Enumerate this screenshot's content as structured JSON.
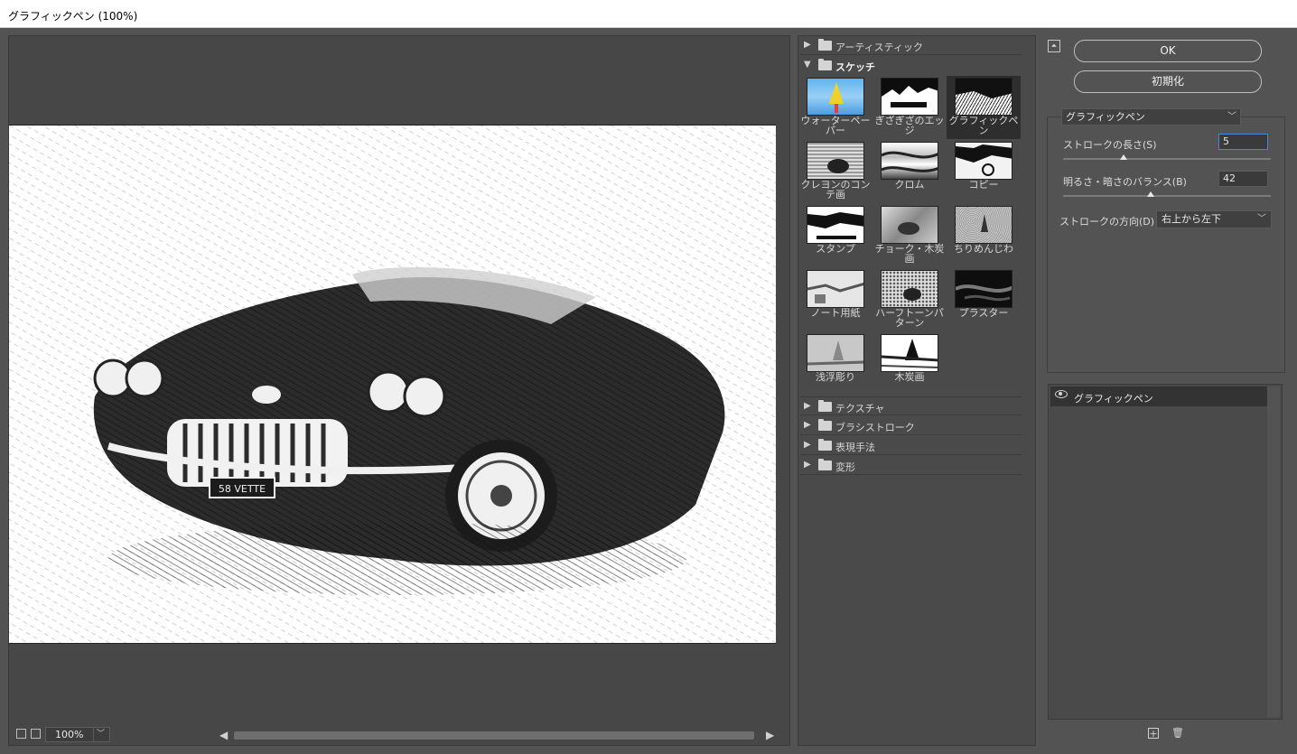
{
  "window": {
    "title": "グラフィックペン (100%)"
  },
  "preview": {
    "zoom": "100%",
    "plate_text": "58 VETTE"
  },
  "filters": {
    "categories_top": [
      {
        "label": "アーティスティック",
        "expanded": false
      },
      {
        "label": "スケッチ",
        "expanded": true
      }
    ],
    "thumbnails": [
      {
        "label": "ウォーターペーパー",
        "selected": false
      },
      {
        "label": "ぎざぎざのエッジ",
        "selected": false
      },
      {
        "label": "グラフィックペン",
        "selected": true
      },
      {
        "label": "クレヨンのコンテ画",
        "selected": false
      },
      {
        "label": "クロム",
        "selected": false
      },
      {
        "label": "コピー",
        "selected": false
      },
      {
        "label": "スタンプ",
        "selected": false
      },
      {
        "label": "チョーク・木炭画",
        "selected": false
      },
      {
        "label": "ちりめんじわ",
        "selected": false
      },
      {
        "label": "ノート用紙",
        "selected": false
      },
      {
        "label": "ハーフトーンパターン",
        "selected": false
      },
      {
        "label": "プラスター",
        "selected": false
      },
      {
        "label": "浅浮彫り",
        "selected": false
      },
      {
        "label": "木炭画",
        "selected": false
      }
    ],
    "categories_bottom": [
      {
        "label": "テクスチャ"
      },
      {
        "label": "ブラシストローク"
      },
      {
        "label": "表現手法"
      },
      {
        "label": "変形"
      }
    ]
  },
  "buttons": {
    "ok": "OK",
    "reset": "初期化"
  },
  "settings": {
    "filter_name": "グラフィックペン",
    "stroke_length_label": "ストロークの長さ(S)",
    "stroke_length_value": "5",
    "stroke_length_fraction": 0.29,
    "balance_label": "明るさ・暗さのバランス(B)",
    "balance_value": "42",
    "balance_fraction": 0.42,
    "direction_label": "ストロークの方向(D) :",
    "direction_value": "右上から左下"
  },
  "layers": [
    {
      "name": "グラフィックペン",
      "visible": true
    }
  ]
}
